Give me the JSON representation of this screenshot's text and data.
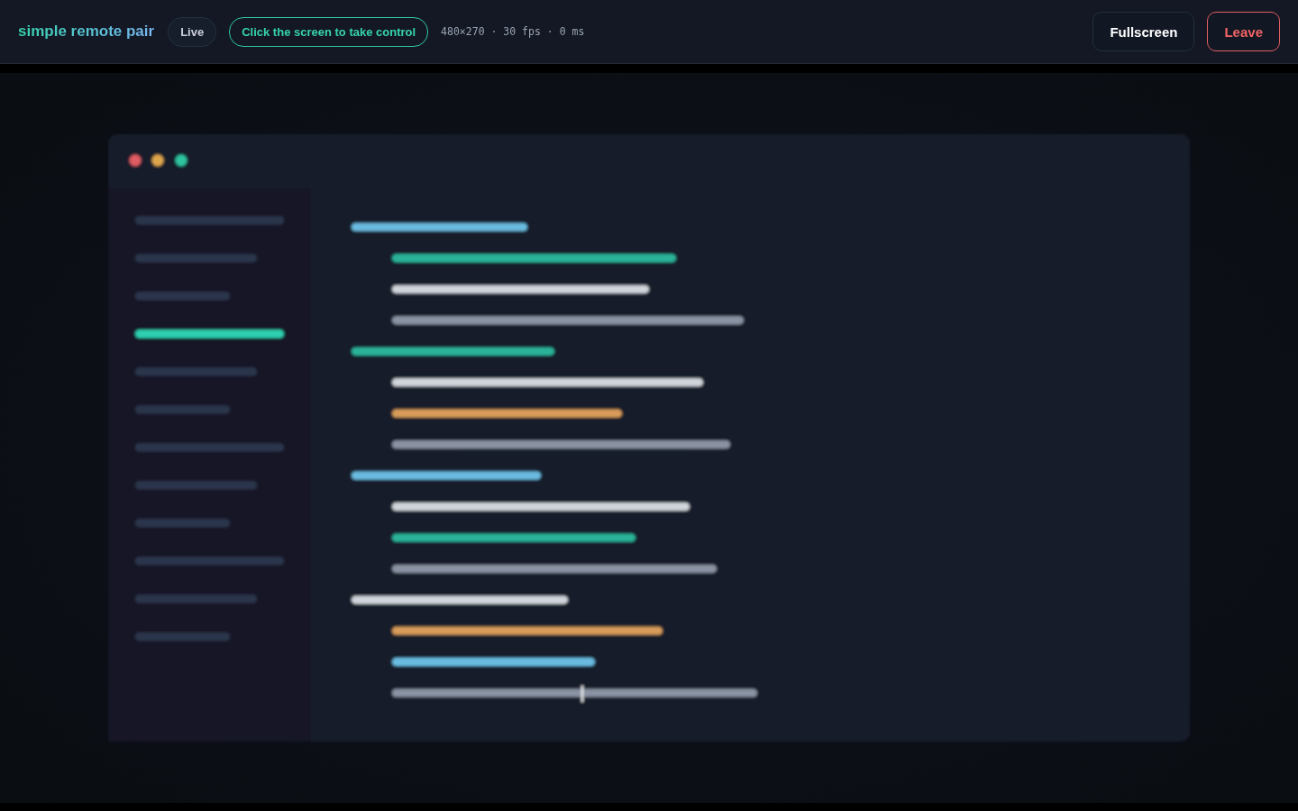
{
  "header": {
    "title": "simple remote pair",
    "status_badge": "Live",
    "control_hint": "Click the screen to take control",
    "stream_stats": "480×270 · 30 fps · 0 ms",
    "buttons": [
      {
        "label": "Fullscreen",
        "kind": "default"
      },
      {
        "label": "Leave",
        "kind": "danger"
      }
    ]
  }
}
